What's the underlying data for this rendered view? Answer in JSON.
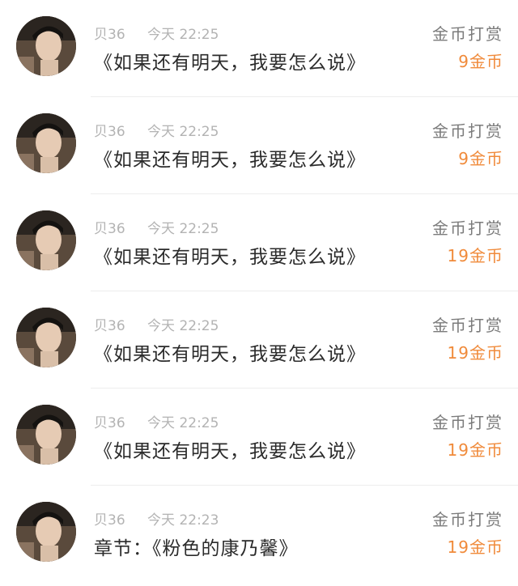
{
  "rewards": [
    {
      "user": "贝36",
      "time": "今天 22:25",
      "title": "《如果还有明天，我要怎么说》",
      "label": "金币打赏",
      "amount": "9金币"
    },
    {
      "user": "贝36",
      "time": "今天 22:25",
      "title": "《如果还有明天，我要怎么说》",
      "label": "金币打赏",
      "amount": "9金币"
    },
    {
      "user": "贝36",
      "time": "今天 22:25",
      "title": "《如果还有明天，我要怎么说》",
      "label": "金币打赏",
      "amount": "19金币"
    },
    {
      "user": "贝36",
      "time": "今天 22:25",
      "title": "《如果还有明天，我要怎么说》",
      "label": "金币打赏",
      "amount": "19金币"
    },
    {
      "user": "贝36",
      "time": "今天 22:25",
      "title": "《如果还有明天，我要怎么说》",
      "label": "金币打赏",
      "amount": "19金币"
    },
    {
      "user": "贝36",
      "time": "今天 22:23",
      "title": "章节：《粉色的康乃馨》",
      "label": "金币打赏",
      "amount": "19金币"
    }
  ],
  "colors": {
    "amount": "#f08a3a",
    "label": "#7b7b7b",
    "meta": "#b3b3b3",
    "title": "#2b2b2b"
  }
}
